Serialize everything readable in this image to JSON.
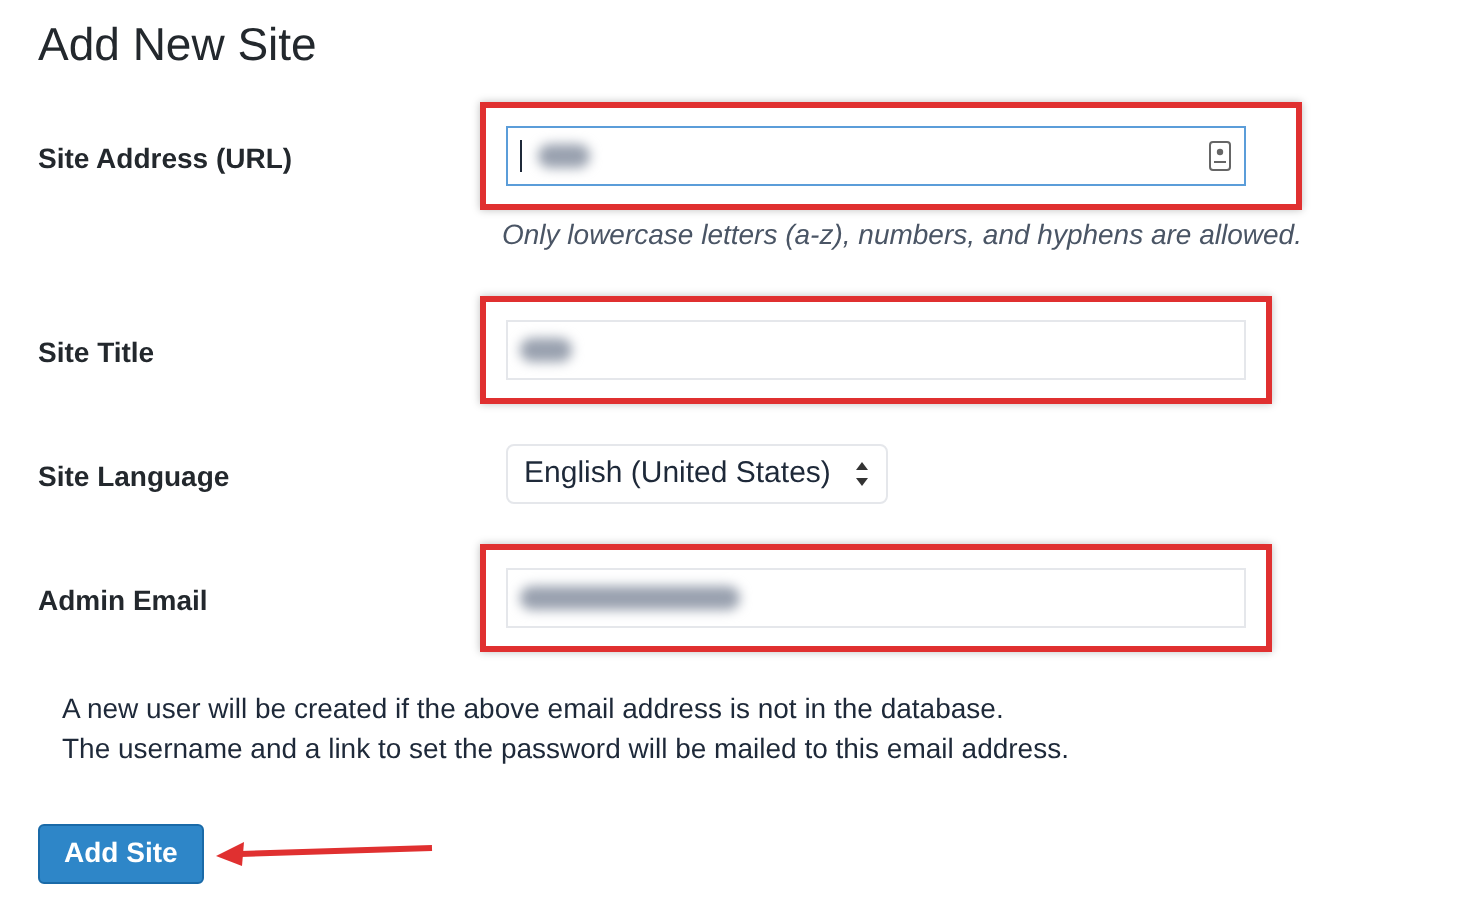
{
  "title": "Add New Site",
  "fields": [
    {
      "kind": "url",
      "label": "Site Address (URL)",
      "highlighted": true,
      "focused": true,
      "redacted": true,
      "hint": "Only lowercase letters (a-z), numbers, and hyphens are allowed."
    },
    {
      "kind": "text",
      "label": "Site Title",
      "highlighted": true,
      "focused": false,
      "redacted": true
    },
    {
      "kind": "select",
      "label": "Site Language",
      "value": "English (United States)"
    },
    {
      "kind": "email",
      "label": "Admin Email",
      "highlighted": true,
      "focused": false,
      "redacted": true
    }
  ],
  "notice": [
    "A new user will be created if the above email address is not in the database.",
    "The username and a link to set the password will be mailed to this email address."
  ],
  "button": {
    "label": "Add Site",
    "annotated": true
  }
}
